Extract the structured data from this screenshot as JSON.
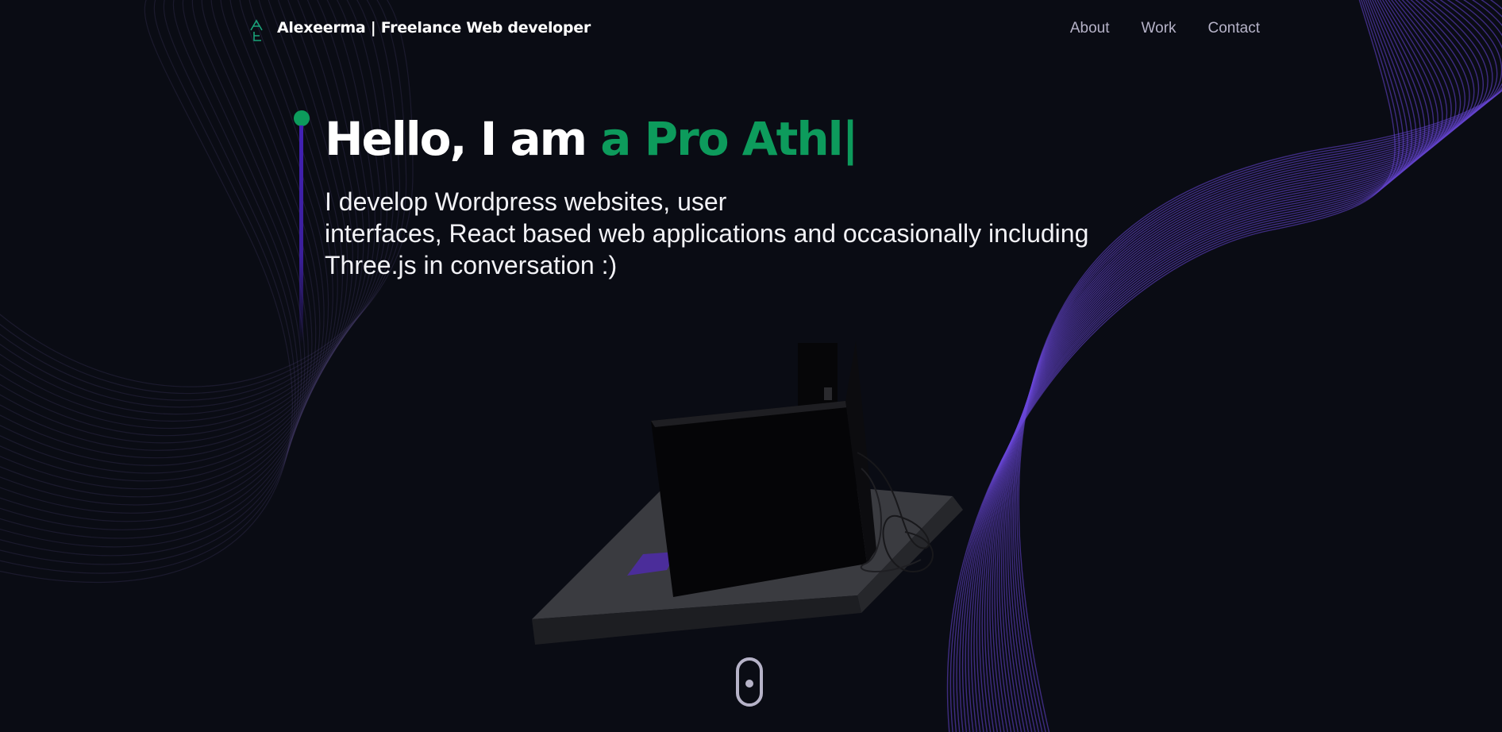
{
  "header": {
    "brand": "Alexeerma | Freelance Web developer",
    "nav": [
      "About",
      "Work",
      "Contact"
    ]
  },
  "hero": {
    "title_prefix": "Hello, I am ",
    "title_typed": "a Pro Athl",
    "caret": "|",
    "description_lines": [
      "I develop Wordpress websites, user",
      "interfaces, React based web applications and occasionally including",
      "Three.js in conversation :)"
    ]
  },
  "colors": {
    "background": "#0a0c14",
    "accent_green": "#0d9b5c",
    "accent_purple": "#4a2fbf",
    "nav_text": "#b6b3c8"
  },
  "icons": {
    "logo": "ae-monogram-icon",
    "scroll": "mouse-scroll-icon"
  }
}
